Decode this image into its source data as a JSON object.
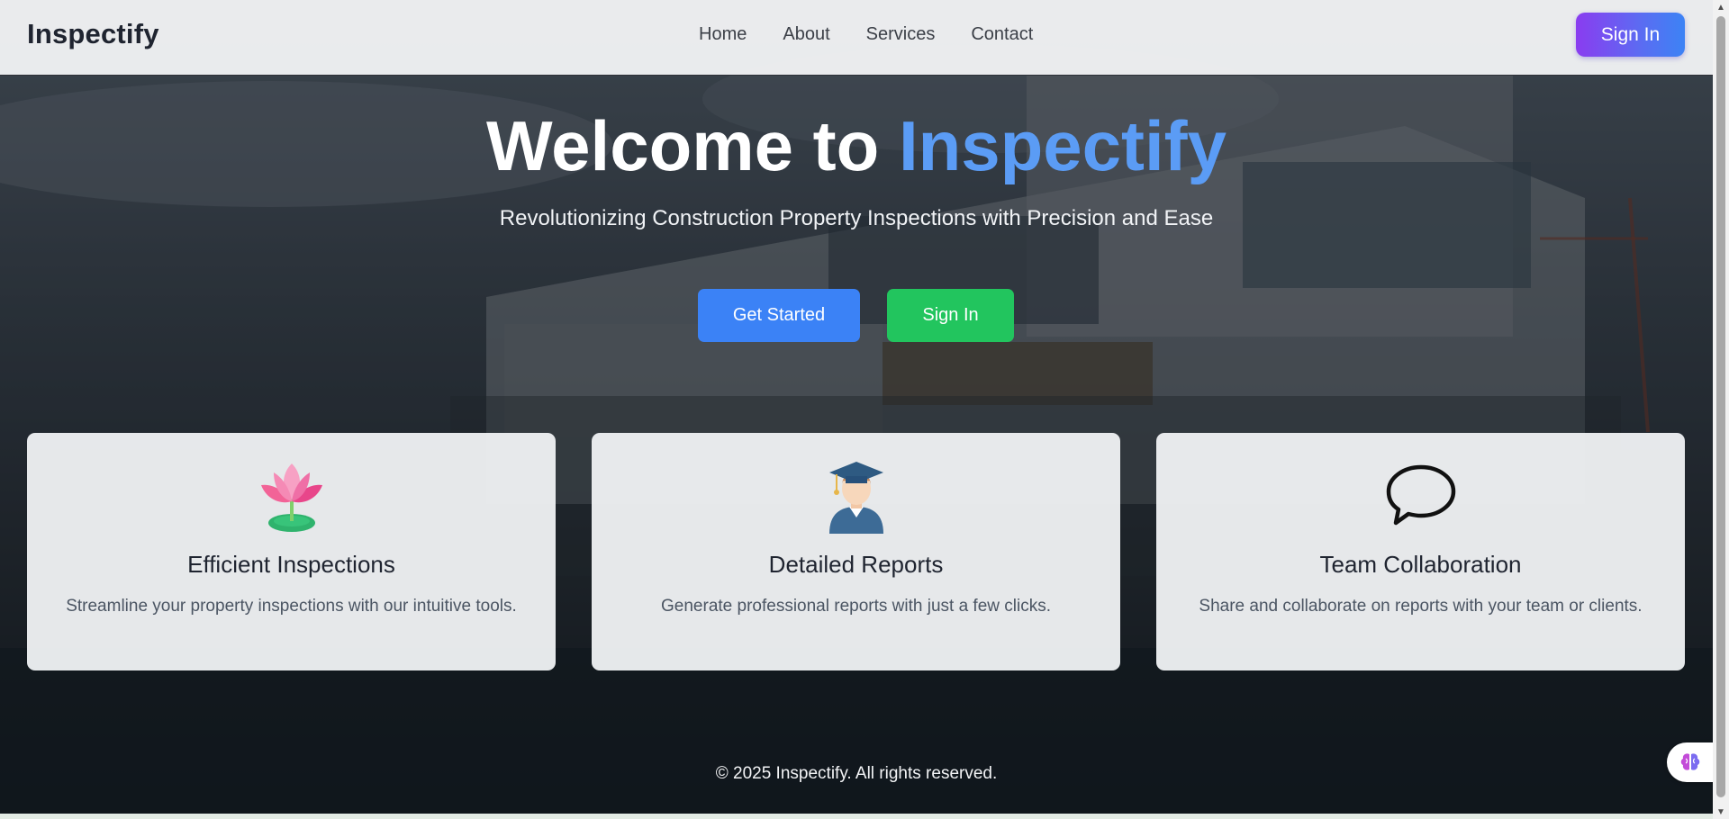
{
  "navbar": {
    "brand": "Inspectify",
    "links": [
      "Home",
      "About",
      "Services",
      "Contact"
    ],
    "signin_label": "Sign In"
  },
  "hero": {
    "title_prefix": "Welcome to ",
    "title_accent": "Inspectify",
    "subtitle": "Revolutionizing Construction Property Inspections with Precision and Ease",
    "get_started_label": "Get Started",
    "signin_label": "Sign In"
  },
  "features": [
    {
      "icon": "lotus-icon",
      "title": "Efficient Inspections",
      "description": "Streamline your property inspections with our intuitive tools."
    },
    {
      "icon": "graduate-icon",
      "title": "Detailed Reports",
      "description": "Generate professional reports with just a few clicks."
    },
    {
      "icon": "speech-bubble-icon",
      "title": "Team Collaboration",
      "description": "Share and collaborate on reports with your team or clients."
    }
  ],
  "footer": {
    "copyright": "© 2025 Inspectify. All rights reserved."
  },
  "colors": {
    "accent": "#5b9cf5",
    "primary_button": "#3b82f6",
    "success_button": "#22c55e",
    "signin_gradient_start": "#8a3cf0",
    "signin_gradient_end": "#3c83f5"
  },
  "widget": {
    "icon": "brain-icon"
  }
}
